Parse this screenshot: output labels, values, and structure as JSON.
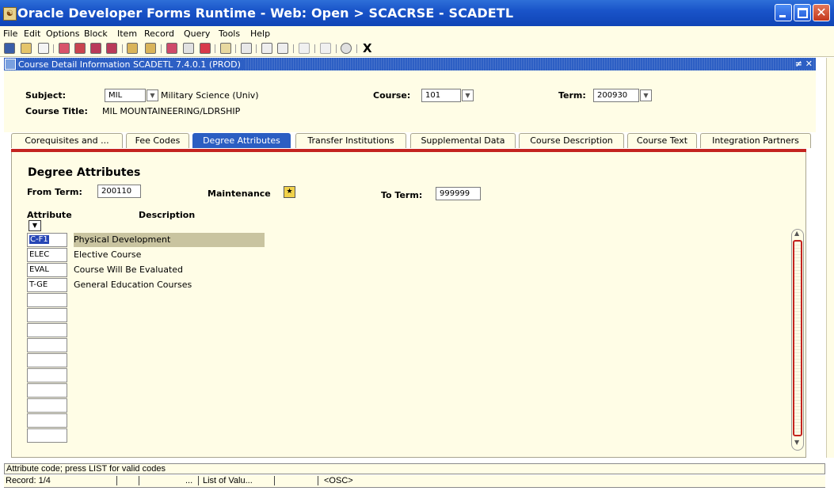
{
  "window": {
    "title": "Oracle Developer Forms Runtime - Web:  Open > SCACRSE - SCADETL",
    "app_icon": "oracle-forms-icon",
    "controls": [
      "minimize-icon",
      "maximize-icon",
      "close-icon"
    ]
  },
  "menu": [
    "File",
    "Edit",
    "Options",
    "Block",
    "Item",
    "Record",
    "Query",
    "Tools",
    "Help"
  ],
  "toolbar": {
    "exit_label": "X",
    "icons": [
      "save-icon",
      "rollback-icon",
      "print-icon",
      "insert-record-icon",
      "remove-record-icon",
      "previous-block-icon",
      "next-block-icon",
      "enter-query-icon",
      "execute-query-icon",
      "cancel-query-icon",
      "options-icon",
      "duplicate-icon",
      "calendar-icon",
      "delete-icon",
      "copy-icon",
      "print-screen-icon",
      "item-properties-icon",
      "export-icon",
      "help-icon"
    ]
  },
  "inner_window": {
    "title": "Course Detail Information  SCADETL  7.4.0.1  (PROD)",
    "controls": "≠ ✕"
  },
  "key_block": {
    "subject_label": "Subject:",
    "subject_value": "MIL",
    "subject_desc": "Military Science (Univ)",
    "course_label": "Course:",
    "course_value": "101",
    "term_label": "Term:",
    "term_value": "200930",
    "course_title_label": "Course Title:",
    "course_title_value": "MIL MOUNTAINEERING/LDRSHIP"
  },
  "tabs": [
    {
      "label": "Corequisites and ...",
      "active": false
    },
    {
      "label": "Fee Codes",
      "active": false
    },
    {
      "label": "Degree Attributes",
      "active": true
    },
    {
      "label": "Transfer Institutions",
      "active": false
    },
    {
      "label": "Supplemental Data",
      "active": false
    },
    {
      "label": "Course Description",
      "active": false
    },
    {
      "label": "Course Text",
      "active": false
    },
    {
      "label": "Integration Partners",
      "active": false
    }
  ],
  "degree_attributes": {
    "heading": "Degree Attributes",
    "from_term_label": "From Term:",
    "from_term_value": "200110",
    "maintenance_label": "Maintenance",
    "to_term_label": "To Term:",
    "to_term_value": "999999",
    "col_attribute": "Attribute",
    "col_description": "Description",
    "rows": [
      {
        "code": "C-F1",
        "description": "Physical Development"
      },
      {
        "code": "ELEC",
        "description": "Elective Course"
      },
      {
        "code": "EVAL",
        "description": "Course Will Be Evaluated"
      },
      {
        "code": "T-GE",
        "description": "General Education Courses"
      },
      {
        "code": "",
        "description": ""
      },
      {
        "code": "",
        "description": ""
      },
      {
        "code": "",
        "description": ""
      },
      {
        "code": "",
        "description": ""
      },
      {
        "code": "",
        "description": ""
      },
      {
        "code": "",
        "description": ""
      },
      {
        "code": "",
        "description": ""
      },
      {
        "code": "",
        "description": ""
      },
      {
        "code": "",
        "description": ""
      },
      {
        "code": "",
        "description": ""
      }
    ]
  },
  "status": {
    "hint": "Attribute code; press LIST for valid codes",
    "record": "Record: 1/4",
    "ellipsis": "...",
    "list_of_values": "List of Valu...",
    "osc": "<OSC>"
  }
}
